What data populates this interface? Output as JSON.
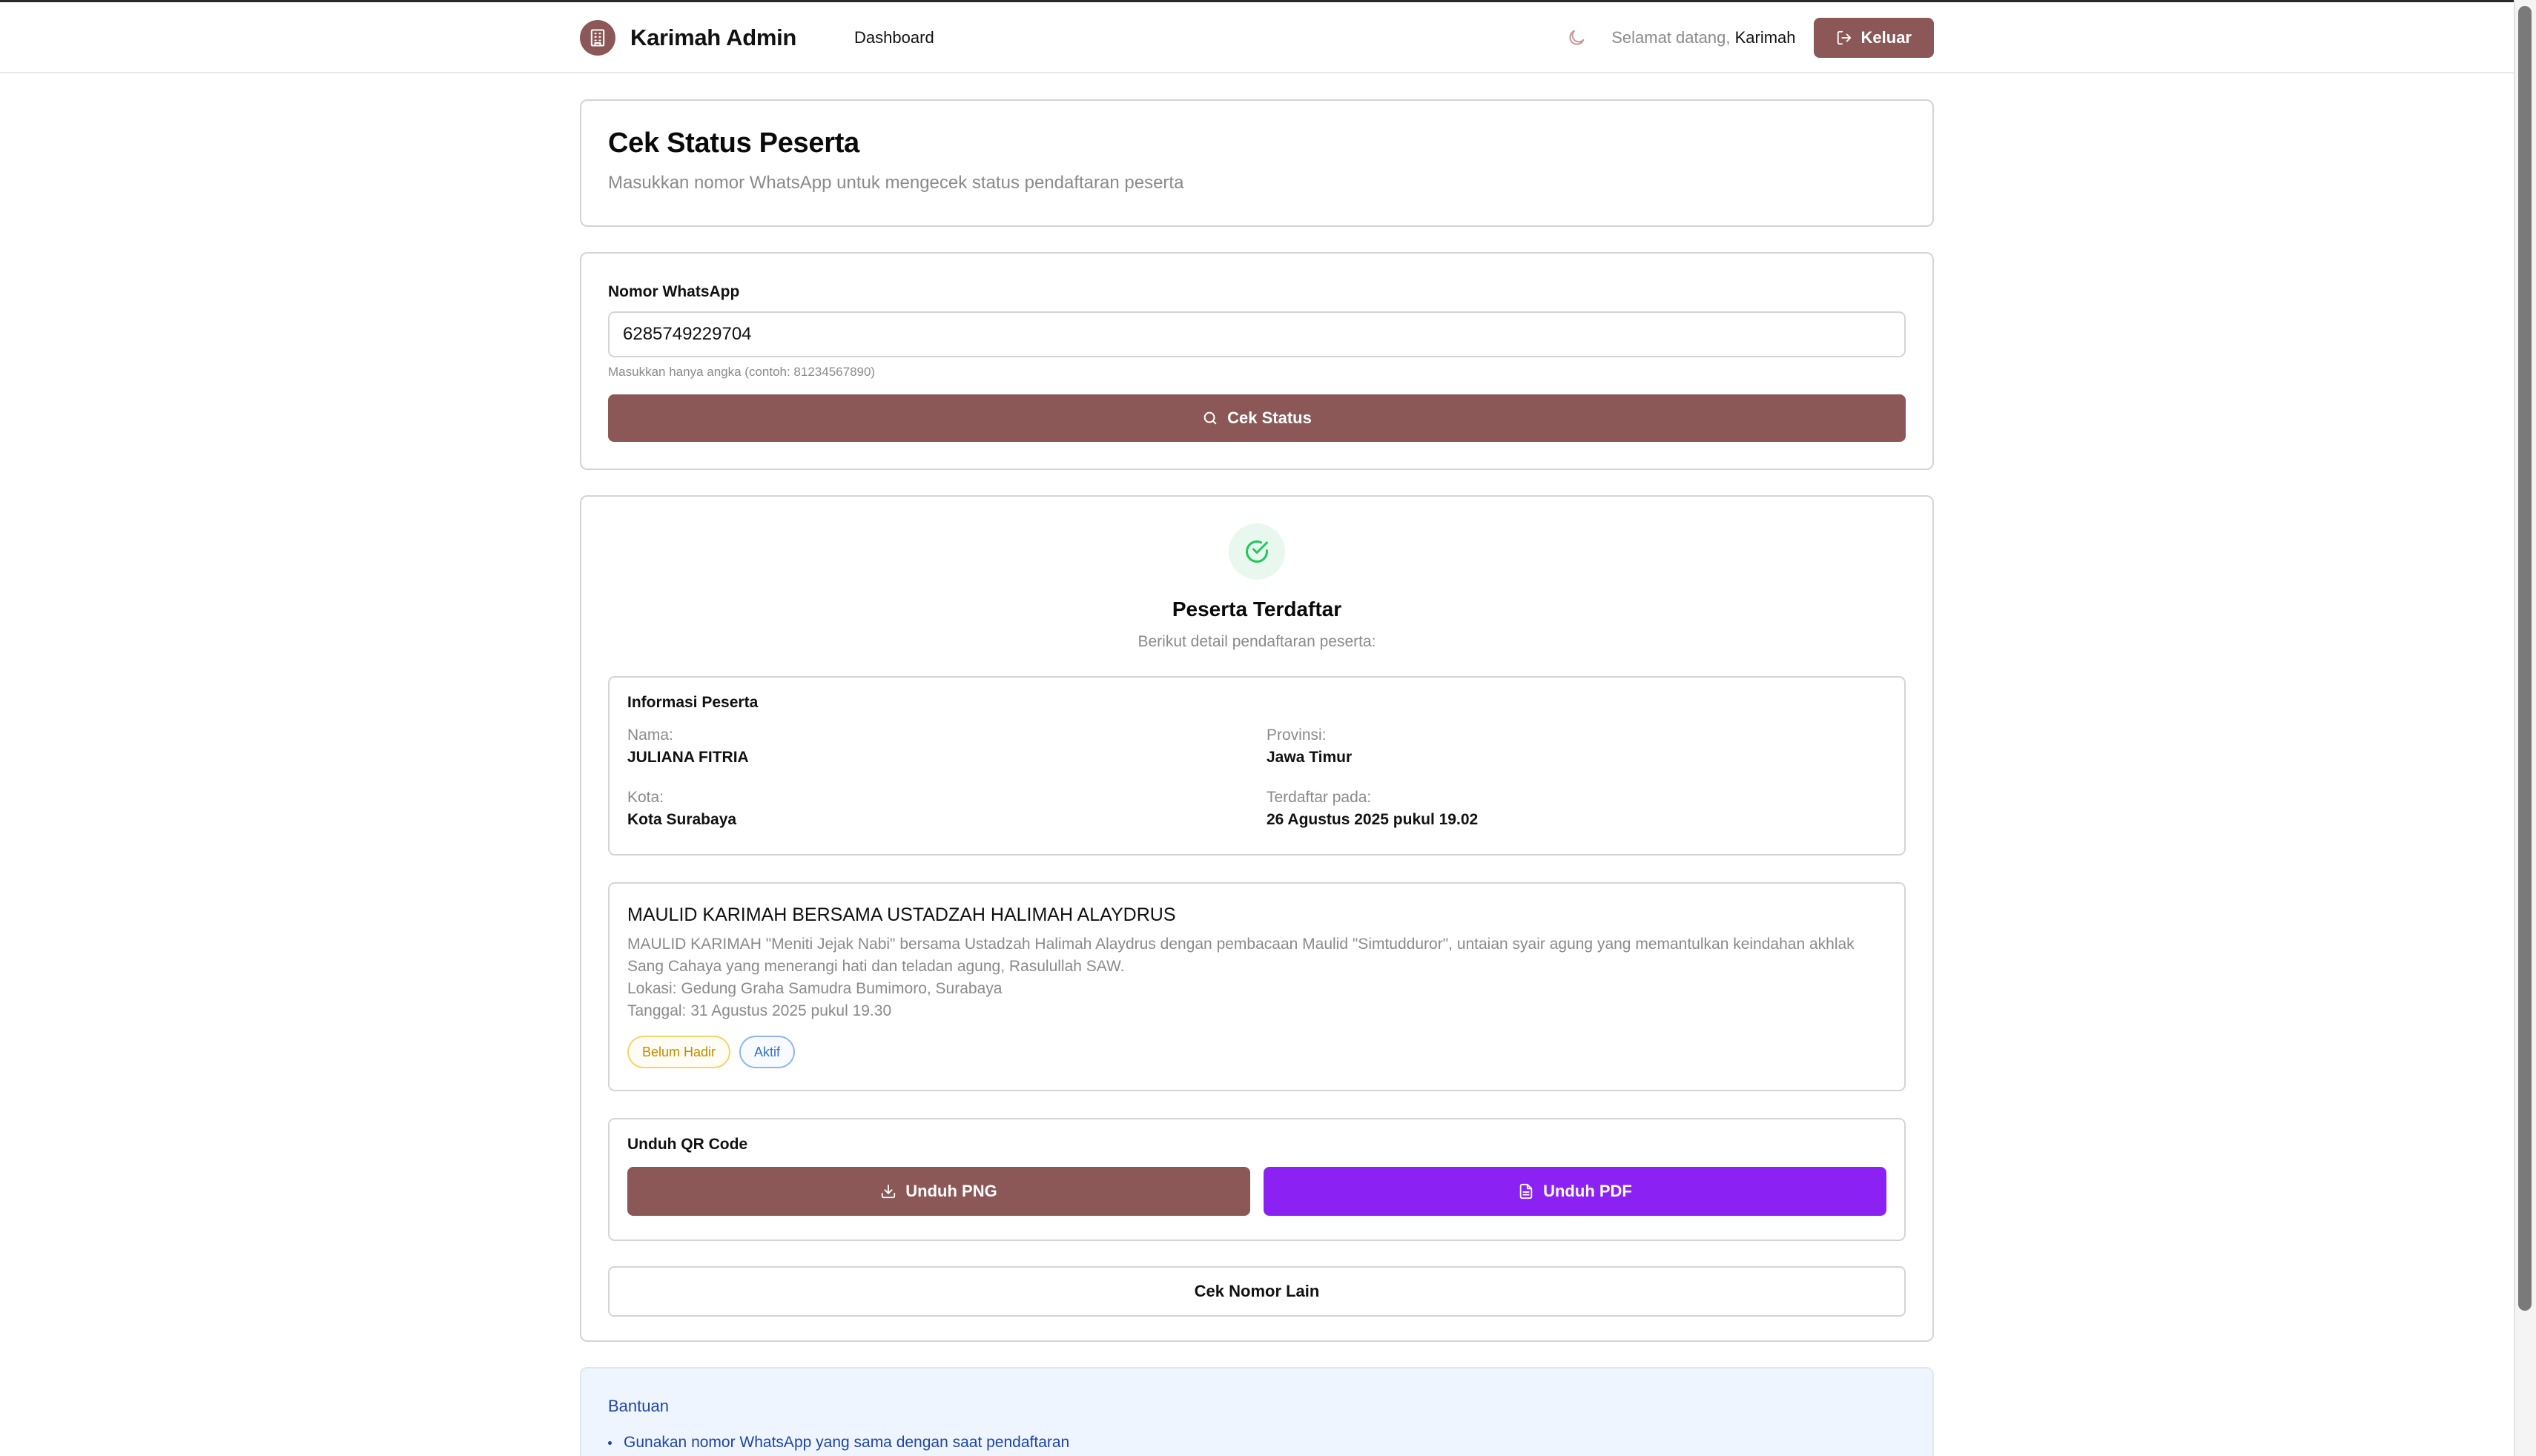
{
  "nav": {
    "brand": "Karimah Admin",
    "dashboard_link": "Dashboard",
    "welcome_prefix": "Selamat datang,",
    "user_name": "Karimah",
    "logout_label": "Keluar"
  },
  "header_card": {
    "title": "Cek Status Peserta",
    "subtitle": "Masukkan nomor WhatsApp untuk mengecek status pendaftaran peserta"
  },
  "form": {
    "label": "Nomor WhatsApp",
    "value": "6285749229704",
    "hint": "Masukkan hanya angka (contoh: 81234567890)",
    "submit_label": "Cek Status"
  },
  "result": {
    "title": "Peserta Terdaftar",
    "subtitle": "Berikut detail pendaftaran peserta:",
    "info": {
      "heading": "Informasi Peserta",
      "name_label": "Nama:",
      "name_value": "JULIANA FITRIA",
      "province_label": "Provinsi:",
      "province_value": "Jawa Timur",
      "city_label": "Kota:",
      "city_value": "Kota Surabaya",
      "registered_label": "Terdaftar pada:",
      "registered_value": "26 Agustus 2025 pukul 19.02"
    },
    "event": {
      "title": "MAULID KARIMAH BERSAMA USTADZAH HALIMAH ALAYDRUS",
      "description": "MAULID KARIMAH \"Meniti Jejak Nabi\" bersama Ustadzah Halimah Alaydrus dengan pembacaan Maulid \"Simtudduror\", untaian syair agung yang memantulkan keindahan akhlak Sang Cahaya yang menerangi hati dan teladan agung, Rasulullah SAW.",
      "location": "Lokasi: Gedung Graha Samudra Bumimoro, Surabaya",
      "date": "Tanggal: 31 Agustus 2025 pukul 19.30",
      "badge_attendance": "Belum Hadir",
      "badge_status": "Aktif"
    },
    "qr": {
      "heading": "Unduh QR Code",
      "png_label": "Unduh PNG",
      "pdf_label": "Unduh PDF"
    },
    "other_label": "Cek Nomor Lain"
  },
  "help": {
    "heading": "Bantuan",
    "items": [
      "Gunakan nomor WhatsApp yang sama dengan saat pendaftaran"
    ]
  },
  "colors": {
    "brand": "#8b5757",
    "pdf_button": "#8b21f2",
    "success": "#22c55e",
    "help_text": "#1f45a8"
  }
}
